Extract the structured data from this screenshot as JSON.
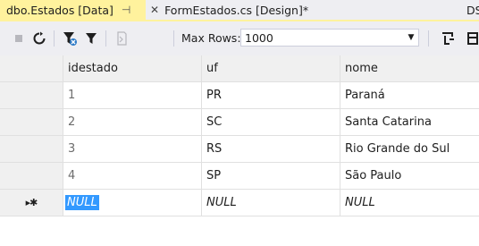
{
  "tabs": {
    "active_title": "dbo.Estados [Data]",
    "pin_glyph": "⊣",
    "second_title": "FormEstados.cs [Design]*",
    "close_glyph": "✕",
    "third_title": "DS"
  },
  "toolbar": {
    "max_rows_label": "Max Rows:",
    "max_rows_value": "1000"
  },
  "grid": {
    "columns": [
      "idestado",
      "uf",
      "nome"
    ],
    "rows": [
      {
        "idestado": "1",
        "uf": "PR",
        "nome": "Paraná"
      },
      {
        "idestado": "2",
        "uf": "SC",
        "nome": "Santa Catarina"
      },
      {
        "idestado": "3",
        "uf": "RS",
        "nome": "Rio Grande do Sul"
      },
      {
        "idestado": "4",
        "uf": "SP",
        "nome": "São Paulo"
      }
    ],
    "new_row": {
      "idestado": "NULL",
      "uf": "NULL",
      "nome": "NULL"
    },
    "new_row_marker": "▸✱"
  },
  "colors": {
    "active_tab": "#fff29d",
    "chrome": "#eeeef2",
    "selection": "#3399ff",
    "filter_icon": "#2b79c6",
    "refresh_icon": "#1e1e1e"
  }
}
